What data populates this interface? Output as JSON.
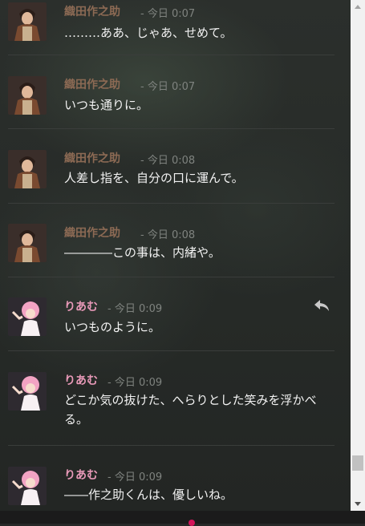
{
  "colors": {
    "oda_name": "#8c6a54",
    "riamu_name": "#e899b8",
    "accent_dot": "#d4145a"
  },
  "messages": [
    {
      "author": "織田作之助",
      "time": "- 今日 0:07",
      "text": "………ああ、じゃあ、せめて。"
    },
    {
      "author": "織田作之助",
      "time": "- 今日 0:07",
      "text": "いつも通りに。"
    },
    {
      "author": "織田作之助",
      "time": "- 今日 0:08",
      "text": "人差し指を、自分の口に運んで。"
    },
    {
      "author": "織田作之助",
      "time": "- 今日 0:08",
      "text": "――――この事は、内緒や。"
    },
    {
      "author": "りあむ",
      "time": "- 今日 0:09",
      "text": "いつものように。"
    },
    {
      "author": "りあむ",
      "time": "- 今日 0:09",
      "text": "どこか気の抜けた、へらりとした笑みを浮かべる。"
    },
    {
      "author": "りあむ",
      "time": "- 今日 0:09",
      "text": "――作之助くんは、優しいね。"
    }
  ],
  "icons": {
    "reply": "reply-icon",
    "scroll_up": "chevron-up-icon",
    "scroll_down": "chevron-down-icon"
  }
}
